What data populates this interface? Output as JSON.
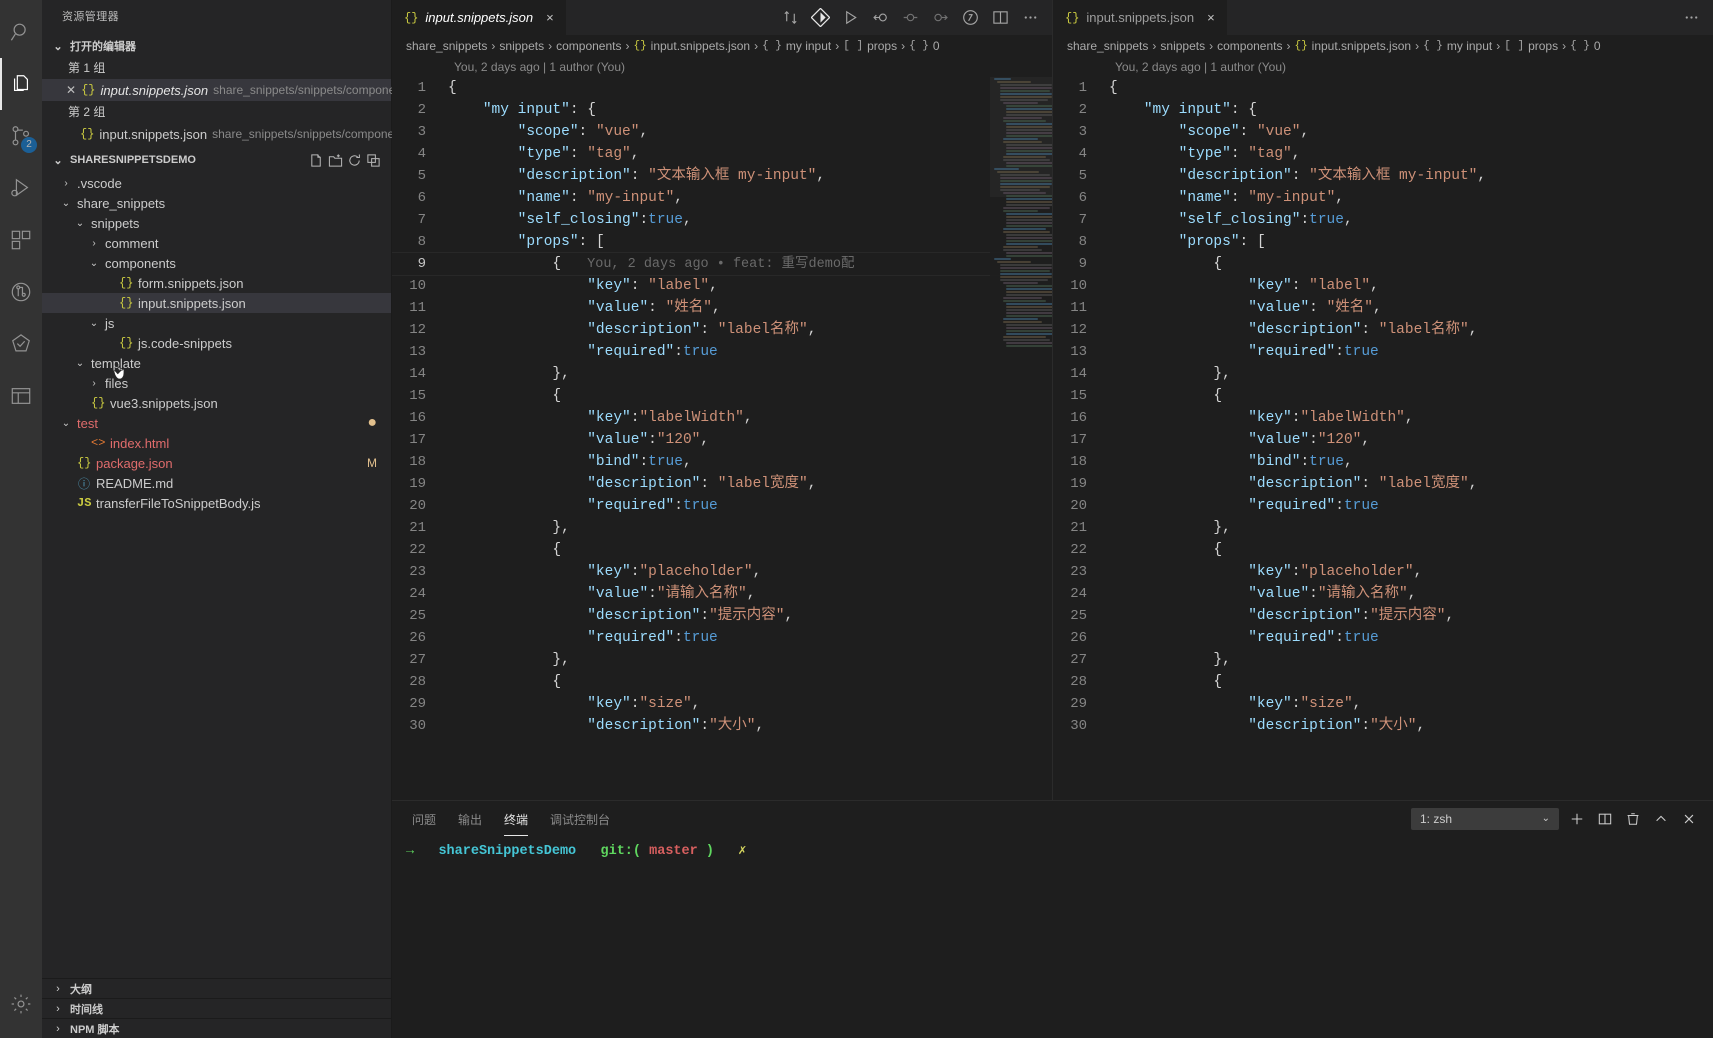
{
  "activitybar": {
    "items": [
      {
        "name": "search",
        "icon": "search-icon"
      },
      {
        "name": "explorer",
        "icon": "files-icon",
        "active": true
      },
      {
        "name": "source-control",
        "icon": "source-control-icon",
        "badge": "2"
      },
      {
        "name": "run-debug",
        "icon": "run-debug-icon"
      },
      {
        "name": "extensions",
        "icon": "extensions-icon"
      },
      {
        "name": "git-graph",
        "icon": "git-graph-icon"
      },
      {
        "name": "test",
        "icon": "beaker-icon"
      },
      {
        "name": "layout",
        "icon": "browser-icon"
      }
    ],
    "settings_label": "manage-gear"
  },
  "sidebar": {
    "title": "资源管理器",
    "open_editors": {
      "label": "打开的编辑器",
      "groups": [
        {
          "label": "第 1 组",
          "items": [
            {
              "name": "input.snippets.json",
              "path": "share_snippets/snippets/components",
              "selected": true,
              "dirty": false,
              "italic": true
            }
          ]
        },
        {
          "label": "第 2 组",
          "items": [
            {
              "name": "input.snippets.json",
              "path": "share_snippets/snippets/components",
              "selected": false,
              "dirty": false,
              "italic": false
            }
          ]
        }
      ]
    },
    "project": {
      "label": "SHARESNIPPETSDEMO",
      "actions": [
        "new-file-icon",
        "new-folder-icon",
        "refresh-icon",
        "collapse-all-icon"
      ],
      "tree": [
        {
          "label": ".vscode",
          "type": "folder",
          "indent": 1,
          "expanded": false
        },
        {
          "label": "share_snippets",
          "type": "folder",
          "indent": 1,
          "expanded": true
        },
        {
          "label": "snippets",
          "type": "folder",
          "indent": 2,
          "expanded": true
        },
        {
          "label": "comment",
          "type": "folder",
          "indent": 3,
          "expanded": false
        },
        {
          "label": "components",
          "type": "folder",
          "indent": 3,
          "expanded": true
        },
        {
          "label": "form.snippets.json",
          "type": "json",
          "indent": 4
        },
        {
          "label": "input.snippets.json",
          "type": "json",
          "indent": 4,
          "selected": true
        },
        {
          "label": "js",
          "type": "folder",
          "indent": 3,
          "expanded": true
        },
        {
          "label": "js.code-snippets",
          "type": "json",
          "indent": 4
        },
        {
          "label": "template",
          "type": "folder",
          "indent": 2,
          "expanded": true
        },
        {
          "label": "files",
          "type": "folder",
          "indent": 3,
          "expanded": false
        },
        {
          "label": "vue3.snippets.json",
          "type": "json",
          "indent": 2
        },
        {
          "label": "test",
          "type": "folder",
          "indent": 1,
          "expanded": true,
          "color": "red",
          "status": "dot"
        },
        {
          "label": "index.html",
          "type": "html",
          "indent": 2,
          "color": "red"
        },
        {
          "label": "package.json",
          "type": "json",
          "indent": 1,
          "color": "red",
          "status": "M"
        },
        {
          "label": "README.md",
          "type": "md",
          "indent": 1
        },
        {
          "label": "transferFileToSnippetBody.js",
          "type": "js",
          "indent": 1
        }
      ]
    },
    "bottom_panels": [
      {
        "label": "大纲"
      },
      {
        "label": "时间线"
      },
      {
        "label": "NPM 脚本"
      }
    ]
  },
  "editors": [
    {
      "tab": {
        "filename": "input.snippets.json",
        "icon": "json-icon",
        "close": "×",
        "italic": true
      },
      "toolbar": [
        "compare-icon",
        "split-json-icon",
        "run-icon",
        "step-back-icon",
        "breakpoint-icon",
        "step-over-icon",
        "debug-alt-icon"
      ],
      "breadcrumbs": [
        "share_snippets",
        "snippets",
        "components",
        "input.snippets.json",
        "my input",
        "props",
        "0"
      ],
      "blame_header": "You, 2 days ago | 1 author (You)",
      "inline_blame": {
        "line": 9,
        "text": "You, 2 days ago • feat: 重写demo配"
      }
    },
    {
      "tab": {
        "filename": "input.snippets.json",
        "icon": "json-icon",
        "close": "×",
        "italic": false
      },
      "toolbar": [
        "split-editor-icon",
        "more-actions-icon"
      ],
      "breadcrumbs": [
        "share_snippets",
        "snippets",
        "components",
        "input.snippets.json",
        "my input",
        "props",
        "0"
      ],
      "blame_header": "You, 2 days ago | 1 author (You)",
      "inline_blame": null
    }
  ],
  "code": {
    "lines": [
      {
        "n": 1,
        "indent": 0,
        "tokens": [
          [
            "p",
            "{"
          ]
        ]
      },
      {
        "n": 2,
        "indent": 1,
        "tokens": [
          [
            "k",
            "\"my input\""
          ],
          [
            "p",
            ": {"
          ]
        ]
      },
      {
        "n": 3,
        "indent": 2,
        "tokens": [
          [
            "k",
            "\"scope\""
          ],
          [
            "p",
            ": "
          ],
          [
            "s",
            "\"vue\""
          ],
          [
            "p",
            ","
          ]
        ]
      },
      {
        "n": 4,
        "indent": 2,
        "tokens": [
          [
            "k",
            "\"type\""
          ],
          [
            "p",
            ": "
          ],
          [
            "s",
            "\"tag\""
          ],
          [
            "p",
            ","
          ]
        ]
      },
      {
        "n": 5,
        "indent": 2,
        "tokens": [
          [
            "k",
            "\"description\""
          ],
          [
            "p",
            ": "
          ],
          [
            "s",
            "\"文本输入框 my-input\""
          ],
          [
            "p",
            ","
          ]
        ]
      },
      {
        "n": 6,
        "indent": 2,
        "tokens": [
          [
            "k",
            "\"name\""
          ],
          [
            "p",
            ": "
          ],
          [
            "s",
            "\"my-input\""
          ],
          [
            "p",
            ","
          ]
        ]
      },
      {
        "n": 7,
        "indent": 2,
        "tokens": [
          [
            "k",
            "\"self_closing\""
          ],
          [
            "p",
            ":"
          ],
          [
            "b",
            "true"
          ],
          [
            "p",
            ","
          ]
        ]
      },
      {
        "n": 8,
        "indent": 2,
        "tokens": [
          [
            "k",
            "\"props\""
          ],
          [
            "p",
            ": ["
          ]
        ]
      },
      {
        "n": 9,
        "indent": 3,
        "tokens": [
          [
            "p",
            "{"
          ]
        ],
        "blame": "You, 2 days ago • feat: 重写demo配"
      },
      {
        "n": 10,
        "indent": 4,
        "tokens": [
          [
            "k",
            "\"key\""
          ],
          [
            "p",
            ": "
          ],
          [
            "s",
            "\"label\""
          ],
          [
            "p",
            ","
          ]
        ]
      },
      {
        "n": 11,
        "indent": 4,
        "tokens": [
          [
            "k",
            "\"value\""
          ],
          [
            "p",
            ": "
          ],
          [
            "s",
            "\"姓名\""
          ],
          [
            "p",
            ","
          ]
        ]
      },
      {
        "n": 12,
        "indent": 4,
        "tokens": [
          [
            "k",
            "\"description\""
          ],
          [
            "p",
            ": "
          ],
          [
            "s",
            "\"label名称\""
          ],
          [
            "p",
            ","
          ]
        ]
      },
      {
        "n": 13,
        "indent": 4,
        "tokens": [
          [
            "k",
            "\"required\""
          ],
          [
            "p",
            ":"
          ],
          [
            "b",
            "true"
          ]
        ]
      },
      {
        "n": 14,
        "indent": 3,
        "tokens": [
          [
            "p",
            "},"
          ]
        ]
      },
      {
        "n": 15,
        "indent": 3,
        "tokens": [
          [
            "p",
            "{"
          ]
        ]
      },
      {
        "n": 16,
        "indent": 4,
        "tokens": [
          [
            "k",
            "\"key\""
          ],
          [
            "p",
            ":"
          ],
          [
            "s",
            "\"labelWidth\""
          ],
          [
            "p",
            ","
          ]
        ]
      },
      {
        "n": 17,
        "indent": 4,
        "tokens": [
          [
            "k",
            "\"value\""
          ],
          [
            "p",
            ":"
          ],
          [
            "s",
            "\"120\""
          ],
          [
            "p",
            ","
          ]
        ]
      },
      {
        "n": 18,
        "indent": 4,
        "tokens": [
          [
            "k",
            "\"bind\""
          ],
          [
            "p",
            ":"
          ],
          [
            "b",
            "true"
          ],
          [
            "p",
            ","
          ]
        ]
      },
      {
        "n": 19,
        "indent": 4,
        "tokens": [
          [
            "k",
            "\"description\""
          ],
          [
            "p",
            ": "
          ],
          [
            "s",
            "\"label宽度\""
          ],
          [
            "p",
            ","
          ]
        ]
      },
      {
        "n": 20,
        "indent": 4,
        "tokens": [
          [
            "k",
            "\"required\""
          ],
          [
            "p",
            ":"
          ],
          [
            "b",
            "true"
          ]
        ]
      },
      {
        "n": 21,
        "indent": 3,
        "tokens": [
          [
            "p",
            "},"
          ]
        ]
      },
      {
        "n": 22,
        "indent": 3,
        "tokens": [
          [
            "p",
            "{"
          ]
        ]
      },
      {
        "n": 23,
        "indent": 4,
        "tokens": [
          [
            "k",
            "\"key\""
          ],
          [
            "p",
            ":"
          ],
          [
            "s",
            "\"placeholder\""
          ],
          [
            "p",
            ","
          ]
        ]
      },
      {
        "n": 24,
        "indent": 4,
        "tokens": [
          [
            "k",
            "\"value\""
          ],
          [
            "p",
            ":"
          ],
          [
            "s",
            "\"请输入名称\""
          ],
          [
            "p",
            ","
          ]
        ]
      },
      {
        "n": 25,
        "indent": 4,
        "tokens": [
          [
            "k",
            "\"description\""
          ],
          [
            "p",
            ":"
          ],
          [
            "s",
            "\"提示内容\""
          ],
          [
            "p",
            ","
          ]
        ]
      },
      {
        "n": 26,
        "indent": 4,
        "tokens": [
          [
            "k",
            "\"required\""
          ],
          [
            "p",
            ":"
          ],
          [
            "b",
            "true"
          ]
        ]
      },
      {
        "n": 27,
        "indent": 3,
        "tokens": [
          [
            "p",
            "},"
          ]
        ]
      },
      {
        "n": 28,
        "indent": 3,
        "tokens": [
          [
            "p",
            "{"
          ]
        ]
      },
      {
        "n": 29,
        "indent": 4,
        "tokens": [
          [
            "k",
            "\"key\""
          ],
          [
            "p",
            ":"
          ],
          [
            "s",
            "\"size\""
          ],
          [
            "p",
            ","
          ]
        ]
      },
      {
        "n": 30,
        "indent": 4,
        "tokens": [
          [
            "k",
            "\"description\""
          ],
          [
            "p",
            ":"
          ],
          [
            "s",
            "\"大小\""
          ],
          [
            "p",
            ","
          ]
        ]
      }
    ]
  },
  "panel": {
    "tabs": [
      {
        "label": "问题",
        "active": false
      },
      {
        "label": "输出",
        "active": false
      },
      {
        "label": "终端",
        "active": true
      },
      {
        "label": "调试控制台",
        "active": false
      }
    ],
    "terminal_select": "1: zsh",
    "actions": [
      "new-terminal-icon",
      "split-terminal-icon",
      "kill-terminal-icon",
      "maximize-panel-icon",
      "close-panel-icon"
    ],
    "prompt": {
      "arrow": "→",
      "dir": "shareSnippetsDemo",
      "git": "git:(",
      "branch": "master",
      "git_close": ")",
      "mark": "✗"
    }
  }
}
